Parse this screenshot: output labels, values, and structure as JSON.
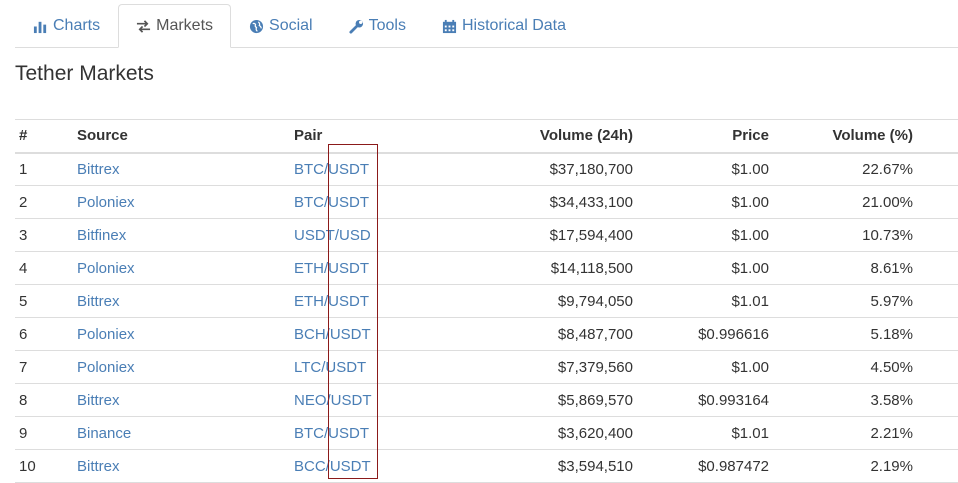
{
  "tabs": [
    {
      "label": "Charts",
      "icon": "bar-chart-icon",
      "active": false
    },
    {
      "label": "Markets",
      "icon": "exchange-arrows-icon",
      "active": true
    },
    {
      "label": "Social",
      "icon": "globe-icon",
      "active": false
    },
    {
      "label": "Tools",
      "icon": "wrench-icon",
      "active": false
    },
    {
      "label": "Historical Data",
      "icon": "calendar-icon",
      "active": false
    }
  ],
  "title": "Tether Markets",
  "table": {
    "headers": {
      "num": "#",
      "source": "Source",
      "pair": "Pair",
      "volume": "Volume (24h)",
      "price": "Price",
      "volume_pct": "Volume (%)"
    },
    "rows": [
      {
        "num": "1",
        "source": "Bittrex",
        "pair": "BTC/USDT",
        "volume": "$37,180,700",
        "price": "$1.00",
        "volume_pct": "22.67%"
      },
      {
        "num": "2",
        "source": "Poloniex",
        "pair": "BTC/USDT",
        "volume": "$34,433,100",
        "price": "$1.00",
        "volume_pct": "21.00%"
      },
      {
        "num": "3",
        "source": "Bitfinex",
        "pair": "USDT/USD",
        "volume": "$17,594,400",
        "price": "$1.00",
        "volume_pct": "10.73%"
      },
      {
        "num": "4",
        "source": "Poloniex",
        "pair": "ETH/USDT",
        "volume": "$14,118,500",
        "price": "$1.00",
        "volume_pct": "8.61%"
      },
      {
        "num": "5",
        "source": "Bittrex",
        "pair": "ETH/USDT",
        "volume": "$9,794,050",
        "price": "$1.01",
        "volume_pct": "5.97%"
      },
      {
        "num": "6",
        "source": "Poloniex",
        "pair": "BCH/USDT",
        "volume": "$8,487,700",
        "price": "$0.996616",
        "volume_pct": "5.18%"
      },
      {
        "num": "7",
        "source": "Poloniex",
        "pair": "LTC/USDT",
        "volume": "$7,379,560",
        "price": "$1.00",
        "volume_pct": "4.50%"
      },
      {
        "num": "8",
        "source": "Bittrex",
        "pair": "NEO/USDT",
        "volume": "$5,869,570",
        "price": "$0.993164",
        "volume_pct": "3.58%"
      },
      {
        "num": "9",
        "source": "Binance",
        "pair": "BTC/USDT",
        "volume": "$3,620,400",
        "price": "$1.01",
        "volume_pct": "2.21%"
      },
      {
        "num": "10",
        "source": "Bittrex",
        "pair": "BCC/USDT",
        "volume": "$3,594,510",
        "price": "$0.987472",
        "volume_pct": "2.19%"
      }
    ]
  },
  "colors": {
    "link": "#4a7eb5",
    "text": "#333333",
    "border": "#dddddd",
    "highlight_box": "#8b1a1a"
  }
}
